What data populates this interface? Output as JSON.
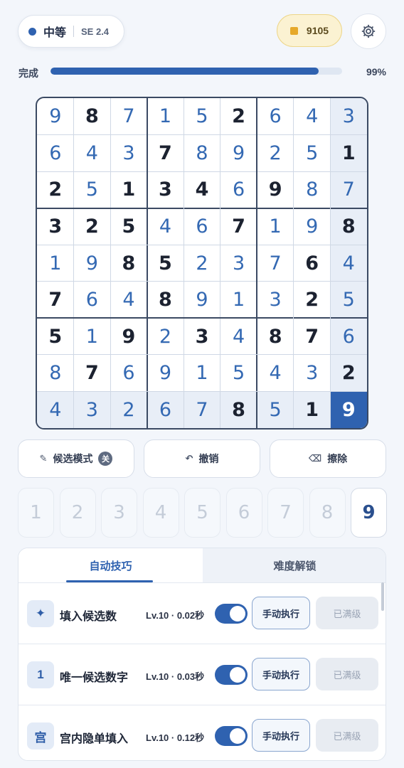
{
  "header": {
    "difficulty": "中等",
    "version": "SE 2.4",
    "coins": "9105",
    "coin_icon": "coin-icon",
    "settings_icon": "gear-icon",
    "accent_color": "#2f62b0"
  },
  "progress": {
    "label": "完成",
    "percent_text": "99%",
    "fraction": 0.99
  },
  "board": {
    "rows": [
      [
        9,
        8,
        7,
        1,
        5,
        2,
        6,
        4,
        3
      ],
      [
        6,
        4,
        3,
        7,
        8,
        9,
        2,
        5,
        1
      ],
      [
        2,
        5,
        1,
        3,
        4,
        6,
        9,
        8,
        7
      ],
      [
        3,
        2,
        5,
        4,
        6,
        7,
        1,
        9,
        8
      ],
      [
        1,
        9,
        8,
        5,
        2,
        3,
        7,
        6,
        4
      ],
      [
        7,
        6,
        4,
        8,
        9,
        1,
        3,
        2,
        5
      ],
      [
        5,
        1,
        9,
        2,
        3,
        4,
        8,
        7,
        6
      ],
      [
        8,
        7,
        6,
        9,
        1,
        5,
        4,
        3,
        2
      ],
      [
        4,
        3,
        2,
        6,
        7,
        8,
        5,
        1,
        9
      ]
    ],
    "given_mask": [
      [
        0,
        1,
        0,
        0,
        0,
        1,
        0,
        0,
        0
      ],
      [
        0,
        0,
        0,
        1,
        0,
        0,
        0,
        0,
        1
      ],
      [
        1,
        0,
        1,
        1,
        1,
        0,
        1,
        0,
        0
      ],
      [
        1,
        1,
        1,
        0,
        0,
        1,
        0,
        0,
        1
      ],
      [
        0,
        0,
        1,
        1,
        0,
        0,
        0,
        1,
        0
      ],
      [
        1,
        0,
        0,
        1,
        0,
        0,
        0,
        1,
        0
      ],
      [
        1,
        0,
        1,
        0,
        1,
        0,
        1,
        1,
        0
      ],
      [
        0,
        1,
        0,
        0,
        0,
        0,
        0,
        0,
        1
      ],
      [
        0,
        0,
        0,
        0,
        0,
        1,
        0,
        1,
        0
      ]
    ],
    "selected": {
      "row": 8,
      "col": 8
    }
  },
  "actions": {
    "candidate_mode": "候选模式",
    "candidate_toggle": "关",
    "undo": "撤销",
    "erase": "擦除"
  },
  "number_pad": [
    "1",
    "2",
    "3",
    "4",
    "5",
    "6",
    "7",
    "8",
    "9"
  ],
  "number_pad_active": "9",
  "panel": {
    "tabs": [
      "自动技巧",
      "难度解锁"
    ],
    "rows": [
      {
        "icon": "✦",
        "name": "填入候选数",
        "meta": "Lv.10 · 0.02秒",
        "enabled": true,
        "run": "手动执行",
        "status": "已满级"
      },
      {
        "icon": "1",
        "name": "唯一候选数字",
        "meta": "Lv.10 · 0.03秒",
        "enabled": true,
        "run": "手动执行",
        "status": "已满级"
      },
      {
        "icon": "宫",
        "name": "宫内隐单填入",
        "meta": "Lv.10 · 0.12秒",
        "enabled": true,
        "run": "手动执行",
        "status": "已满级"
      }
    ]
  }
}
